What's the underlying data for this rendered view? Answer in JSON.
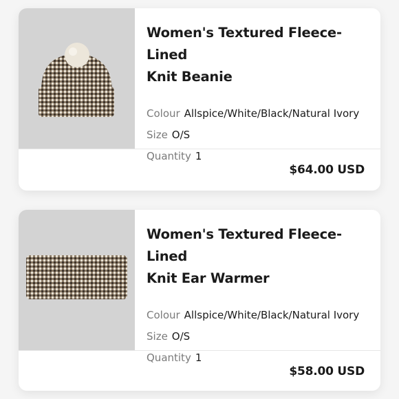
{
  "items": [
    {
      "title_line1": "Women's Textured Fleece-Lined",
      "title_line2": "Knit Beanie",
      "colour_label": "Colour",
      "colour_value": "Allspice/White/Black/Natural Ivory",
      "size_label": "Size",
      "size_value": "O/S",
      "quantity_label": "Quantity",
      "quantity_value": "1",
      "price": "$64.00 USD",
      "image_icon": "beanie-image"
    },
    {
      "title_line1": "Women's Textured Fleece-Lined",
      "title_line2": "Knit Ear Warmer",
      "colour_label": "Colour",
      "colour_value": "Allspice/White/Black/Natural Ivory",
      "size_label": "Size",
      "size_value": "O/S",
      "quantity_label": "Quantity",
      "quantity_value": "1",
      "price": "$58.00 USD",
      "image_icon": "ear-warmer-image"
    }
  ],
  "colors": {
    "page_bg": "#f5f5f5",
    "card_bg": "#ffffff",
    "thumb_bg": "#d3d3d3",
    "label_gray": "#7a7a7a",
    "text_dark": "#1a1a1a"
  }
}
